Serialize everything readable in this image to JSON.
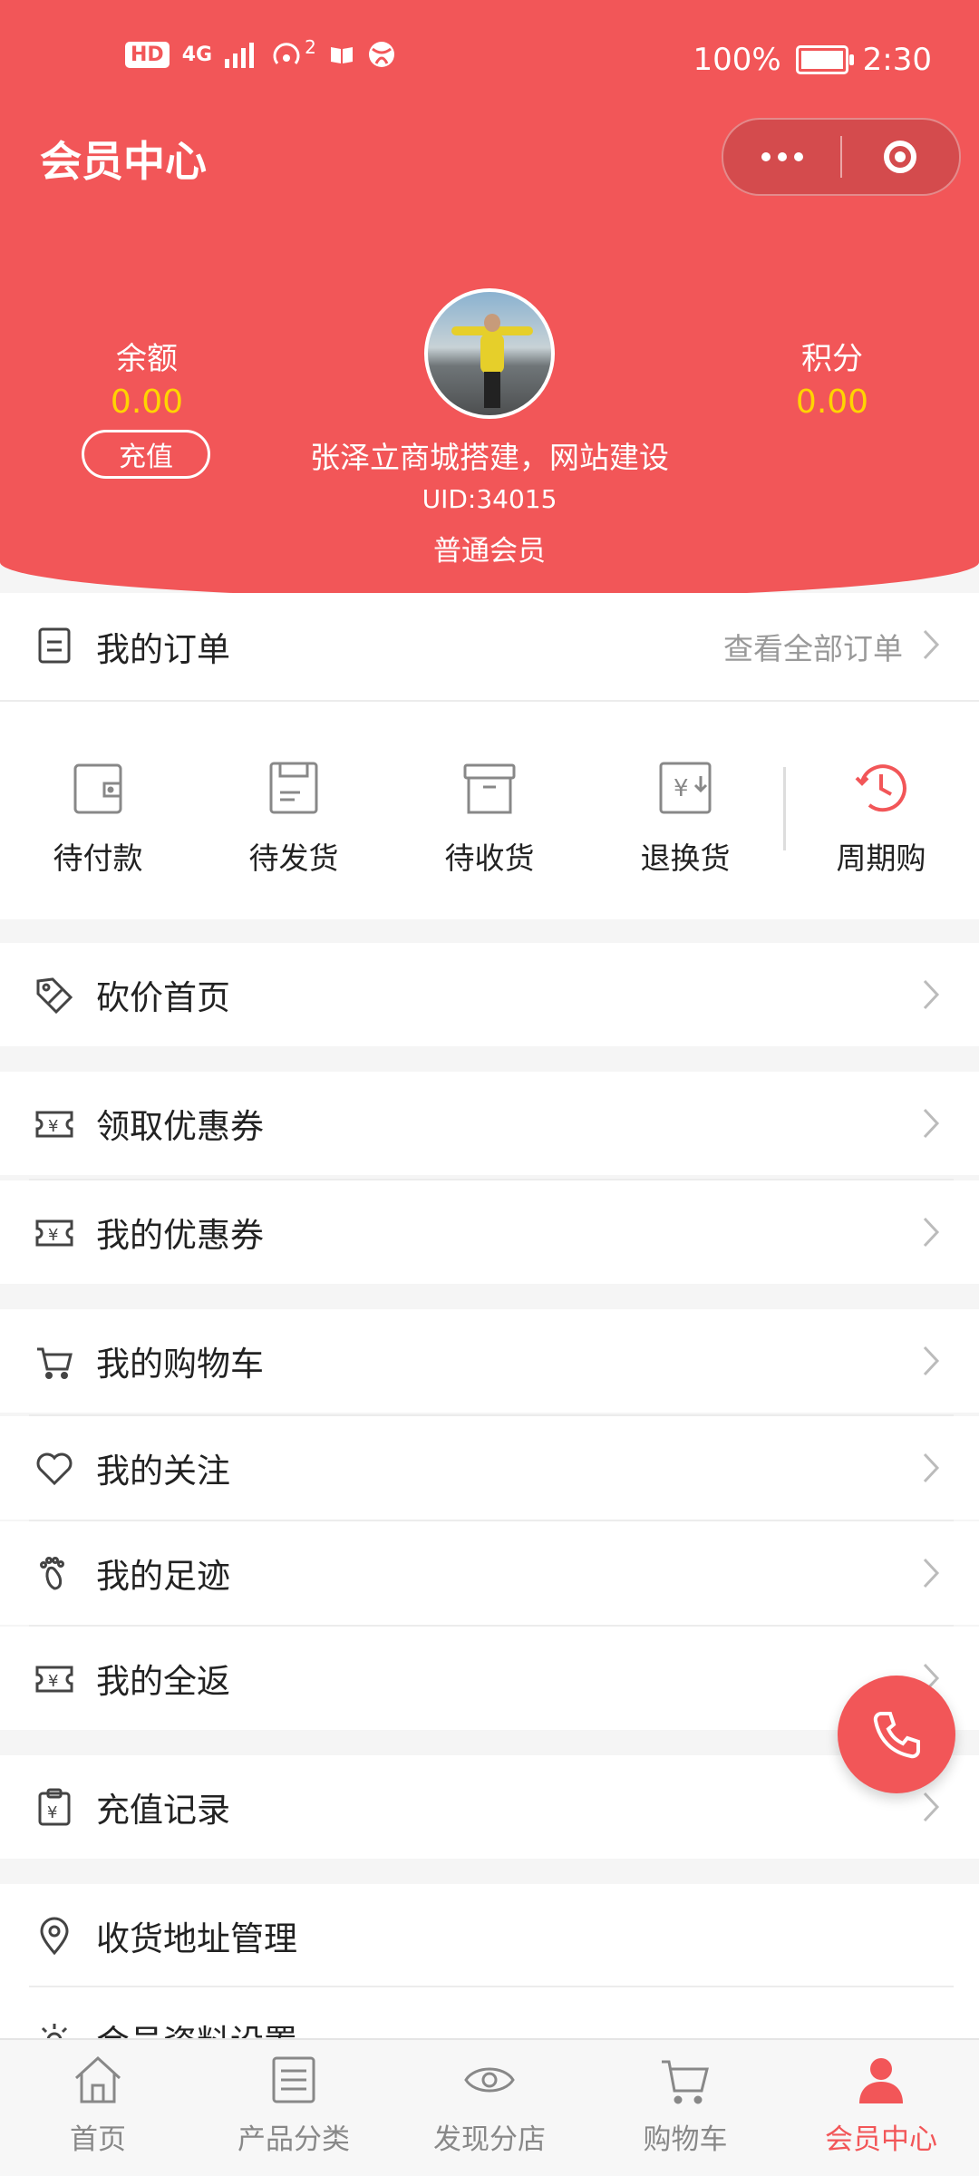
{
  "status_bar": {
    "badges": [
      "HD",
      "4G"
    ],
    "notification_count": "2",
    "battery": "100%",
    "time": "2:30"
  },
  "header": {
    "title": "会员中心"
  },
  "profile": {
    "balance_label": "余额",
    "balance_value": "0.00",
    "recharge_button": "充值",
    "points_label": "积分",
    "points_value": "0.00",
    "name": "张泽立商城搭建，网站建设",
    "uid": "UID:34015",
    "level": "普通会员"
  },
  "orders": {
    "title": "我的订单",
    "view_all": "查看全部订单",
    "items": [
      {
        "label": "待付款",
        "icon": "wallet-icon"
      },
      {
        "label": "待发货",
        "icon": "box-icon"
      },
      {
        "label": "待收货",
        "icon": "package-icon"
      },
      {
        "label": "退换货",
        "icon": "refund-icon"
      },
      {
        "label": "周期购",
        "icon": "clock-icon"
      }
    ]
  },
  "menu": {
    "bargain": "砍价首页",
    "get_coupons": "领取优惠券",
    "my_coupons": "我的优惠券",
    "cart": "我的购物车",
    "follow": "我的关注",
    "footprint": "我的足迹",
    "cashback": "我的全返",
    "recharge_record": "充值记录",
    "address": "收货地址管理",
    "profile_settings": "会员资料设置"
  },
  "tabbar": {
    "items": [
      {
        "label": "首页",
        "icon": "home-icon"
      },
      {
        "label": "产品分类",
        "icon": "list-icon"
      },
      {
        "label": "发现分店",
        "icon": "eye-icon"
      },
      {
        "label": "购物车",
        "icon": "cart-icon"
      },
      {
        "label": "会员中心",
        "icon": "user-icon",
        "active": true
      }
    ]
  },
  "colors": {
    "accent": "#f25658",
    "highlight": "#ffd400"
  }
}
